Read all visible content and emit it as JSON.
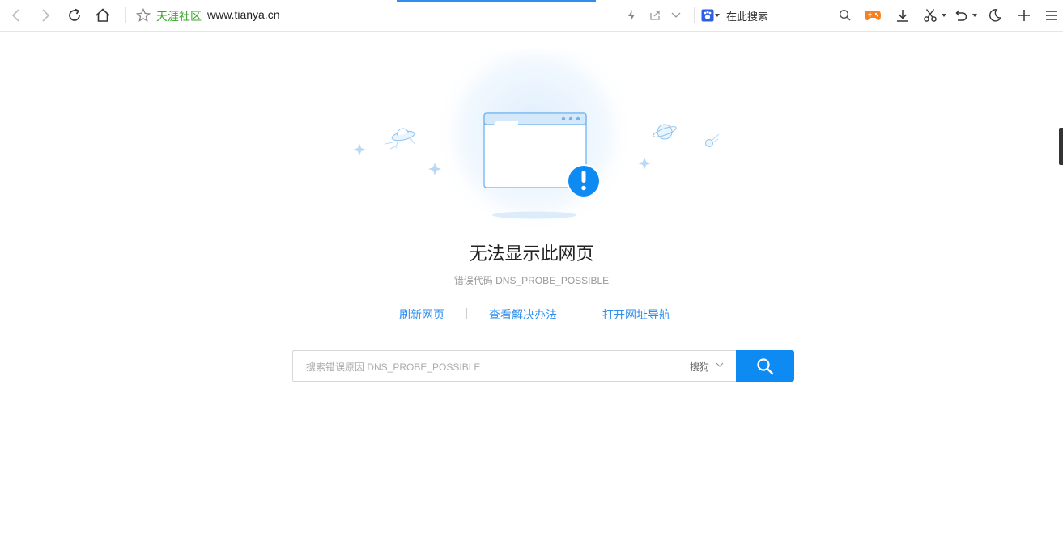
{
  "browser": {
    "site_name": "天涯社区",
    "url": "www.tianya.cn",
    "search_engine_label": "在此搜索"
  },
  "error": {
    "title": "无法显示此网页",
    "code_text": "错误代码 DNS_PROBE_POSSIBLE",
    "links": [
      "刷新网页",
      "查看解决办法",
      "打开网址导航"
    ],
    "search_placeholder": "搜索错误原因 DNS_PROBE_POSSIBLE",
    "search_engine": "搜狗"
  },
  "colors": {
    "accent": "#0d8bf2",
    "link": "#2e8ef0",
    "site_green": "#3aa52b",
    "game_orange": "#f5821f"
  }
}
